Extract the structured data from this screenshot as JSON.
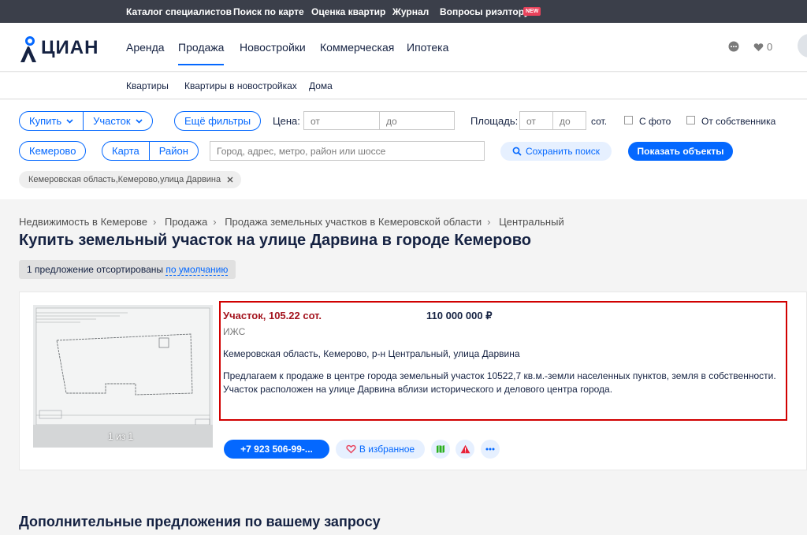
{
  "topbar": {
    "links": [
      "Каталог специалистов",
      "Поиск по карте",
      "Оценка квартир",
      "Журнал",
      "Вопросы риэлтору"
    ],
    "badge": "NEW"
  },
  "header": {
    "logo": "ЦИАН",
    "nav": [
      "Аренда",
      "Продажа",
      "Новостройки",
      "Коммерческая",
      "Ипотека"
    ],
    "active_nav": "Продажа",
    "favorites_count": "0"
  },
  "subnav": [
    "Квартиры",
    "Квартиры в новостройках",
    "Дома"
  ],
  "filters": {
    "deal_type": "Купить",
    "object_type": "Участок",
    "more_filters": "Ещё фильтры",
    "price_label": "Цена:",
    "price_from": "от",
    "price_to": "до",
    "area_label": "Площадь:",
    "area_from": "от",
    "area_to": "до",
    "area_unit": "сот.",
    "with_photo": "С фото",
    "from_owner": "От собственника",
    "city": "Кемерово",
    "map": "Карта",
    "district": "Район",
    "search_placeholder": "Город, адрес, метро, район или шоссе",
    "save_search": "Сохранить поиск",
    "show_objects": "Показать объекты",
    "chip": "Кемеровская область,Кемерово,улица Дарвина"
  },
  "breadcrumbs": [
    "Недвижимость в Кемерове",
    "Продажа",
    "Продажа земельных участков в Кемеровской области",
    "Центральный"
  ],
  "page_title": "Купить земельный участок на улице Дарвина в городе Кемерово",
  "sort": {
    "text": "1 предложение отсортированы",
    "link": "по умолчанию"
  },
  "offer": {
    "photo_counter": "1 из 1",
    "title": "Участок, 105.22 сот.",
    "price": "110 000 000 ₽",
    "subtitle": "ИЖС",
    "address": "Кемеровская область, Кемерово, р-н Центральный, улица Дарвина",
    "description": "Предлагаем к продаже в центре города земельный участок 10522,7 кв.м.-земли населенных пунктов, земля в собственности. Участок расположен на улице Дарвина вблизи исторического и делового центра города.",
    "phone": "+7 923 506-99-...",
    "favorite": "В избранное"
  },
  "more_offers_title": "Дополнительные предложения по вашему запросу",
  "colors": {
    "accent": "#0468ff",
    "topbar": "#3b3f4a",
    "offer_title": "#a4141e",
    "highlight": "#d10000"
  }
}
